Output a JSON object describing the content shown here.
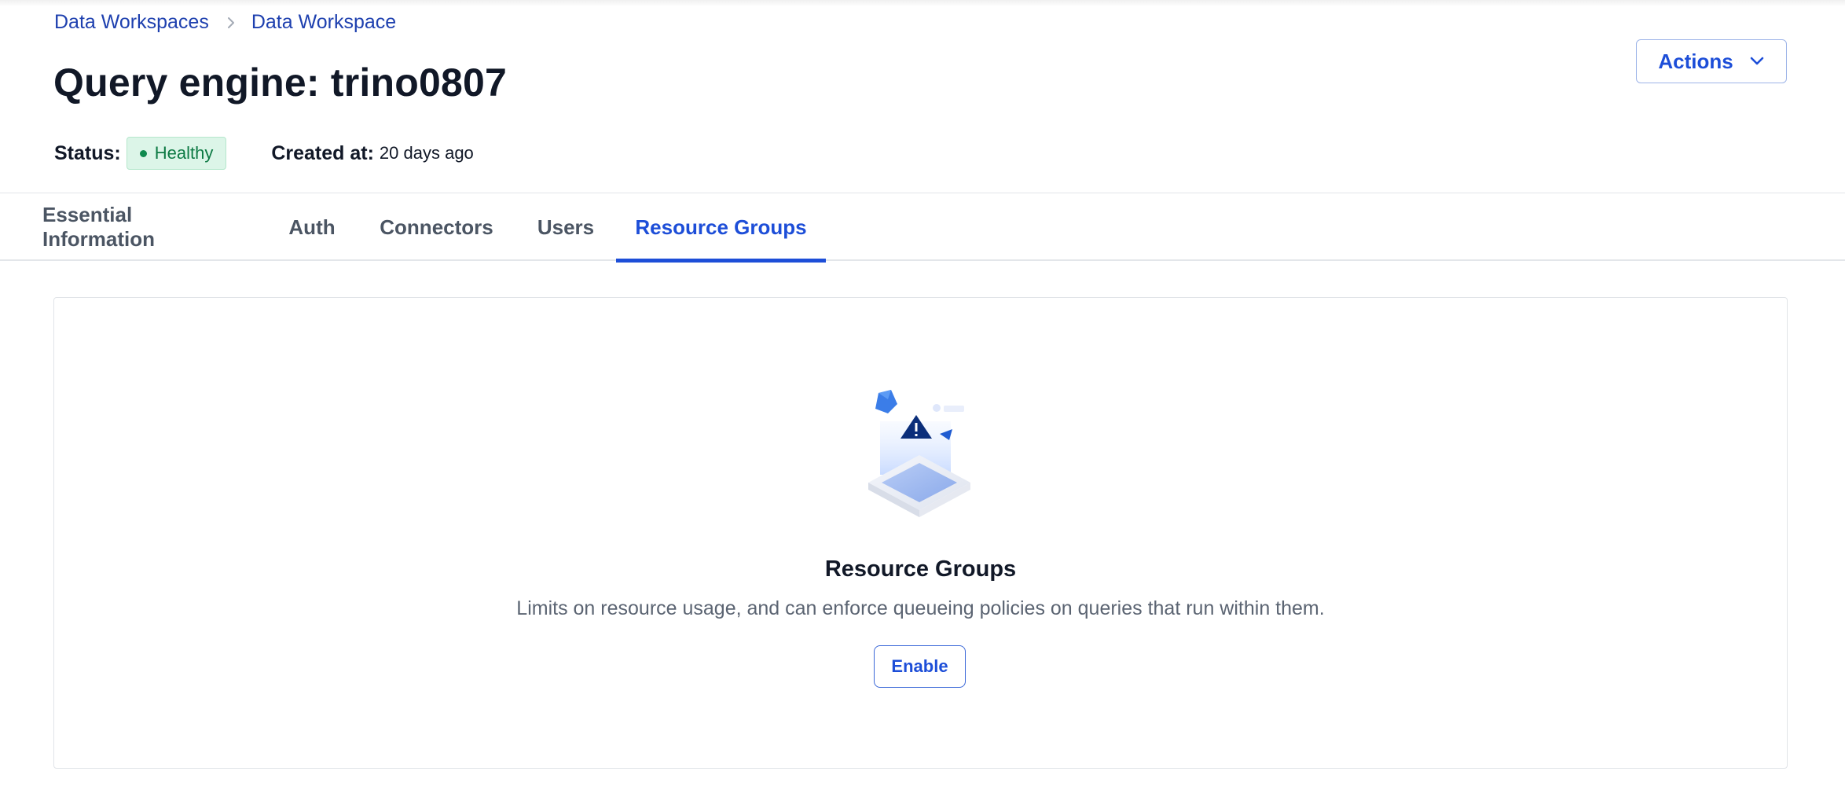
{
  "breadcrumb": {
    "items": [
      "Data Workspaces",
      "Data Workspace"
    ]
  },
  "page": {
    "title": "Query engine: trino0807"
  },
  "actions": {
    "label": "Actions"
  },
  "meta": {
    "status_label": "Status:",
    "status_value": "Healthy",
    "created_label": "Created at:",
    "created_value": "20 days ago"
  },
  "tabs": [
    {
      "label": "Essential Information",
      "active": false
    },
    {
      "label": "Auth",
      "active": false
    },
    {
      "label": "Connectors",
      "active": false
    },
    {
      "label": "Users",
      "active": false
    },
    {
      "label": "Resource Groups",
      "active": true
    }
  ],
  "empty_state": {
    "title": "Resource Groups",
    "description": "Limits on resource usage, and can enforce queueing policies on queries that run within them.",
    "button_label": "Enable"
  },
  "icons": {
    "breadcrumb_separator": "chevron-right-icon",
    "actions_dropdown": "chevron-down-icon",
    "illustration": "warning-box-illustration",
    "status_dot": "status-dot-icon"
  },
  "colors": {
    "accent": "#1d4ed8",
    "link": "#1e40af",
    "healthy_text": "#0d7a44",
    "healthy_bg": "#dcf5e8"
  }
}
